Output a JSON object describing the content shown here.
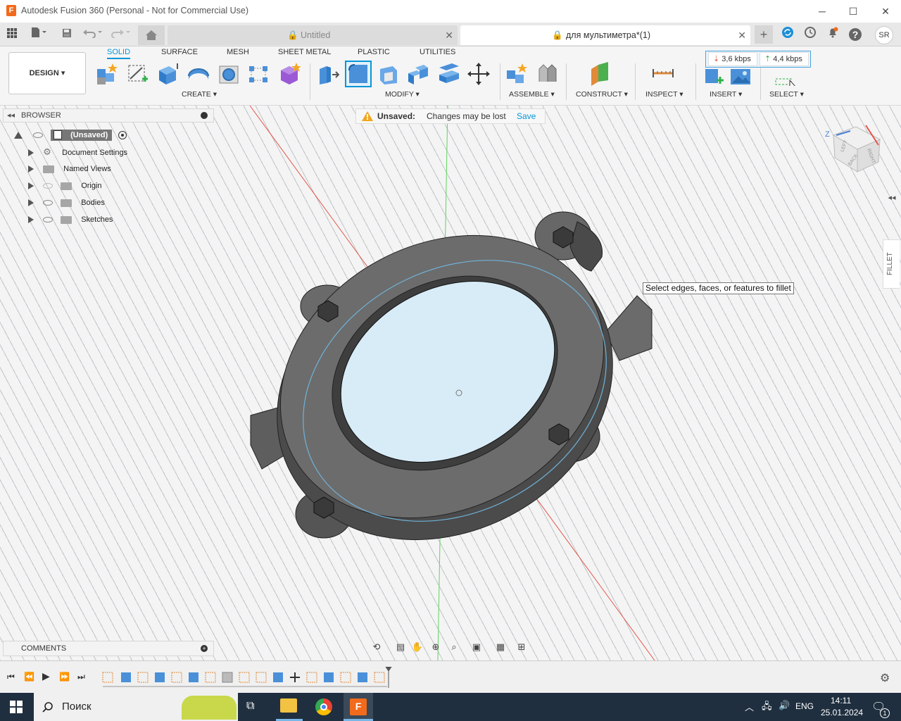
{
  "window": {
    "title": "Autodesk Fusion 360 (Personal - Not for Commercial Use)",
    "app_icon_letter": "F",
    "minimize": "─",
    "maximize": "☐",
    "close": "✕"
  },
  "tabs": [
    {
      "label": "Untitled",
      "close": "✕",
      "active": false
    },
    {
      "label": "для мультиметра*(1)",
      "close": "✕",
      "active": true
    }
  ],
  "tabbar_right": {
    "user_initials": "SR",
    "help": "?",
    "add": "+"
  },
  "ribbon": {
    "workspace": "DESIGN",
    "workspace_caret": "▾",
    "tabs": [
      "SOLID",
      "SURFACE",
      "MESH",
      "SHEET METAL",
      "PLASTIC",
      "UTILITIES"
    ],
    "active_tab": "SOLID",
    "groups": [
      {
        "label": "CREATE ▾"
      },
      {
        "label": "MODIFY ▾"
      },
      {
        "label": "ASSEMBLE ▾"
      },
      {
        "label": "CONSTRUCT ▾"
      },
      {
        "label": "INSPECT ▾"
      },
      {
        "label": "INSERT ▾"
      },
      {
        "label": "SELECT ▾"
      }
    ],
    "net": {
      "download": "3,6 kbps",
      "upload": "4,4 kbps"
    }
  },
  "browser": {
    "title": "BROWSER",
    "root": "(Unsaved)",
    "items": [
      {
        "label": "Document Settings"
      },
      {
        "label": "Named Views"
      },
      {
        "label": "Origin"
      },
      {
        "label": "Bodies"
      },
      {
        "label": "Sketches"
      }
    ]
  },
  "unsaved_bar": {
    "label": "Unsaved:",
    "message": "Changes may be lost",
    "save": "Save"
  },
  "viewcube": {
    "axis_z": "Z",
    "face_left": "LEFT",
    "face_back": "BACK",
    "face_right": "RIGHT"
  },
  "tooltip": "Select edges, faces, or features to fillet",
  "right_panel": {
    "label": "FILLET"
  },
  "comments": {
    "title": "COMMENTS"
  },
  "taskbar": {
    "search": "Поиск",
    "lang": "ENG",
    "time": "14:11",
    "date": "25.01.2024",
    "notif_count": "1"
  },
  "colors": {
    "accent": "#0696d7",
    "ribbon_bg": "#f5f5f5",
    "taskbar_bg": "#1f2f3f",
    "warning": "#f2a61b",
    "part_body": "#6b6b6b",
    "glass": "#d8ecf7"
  }
}
